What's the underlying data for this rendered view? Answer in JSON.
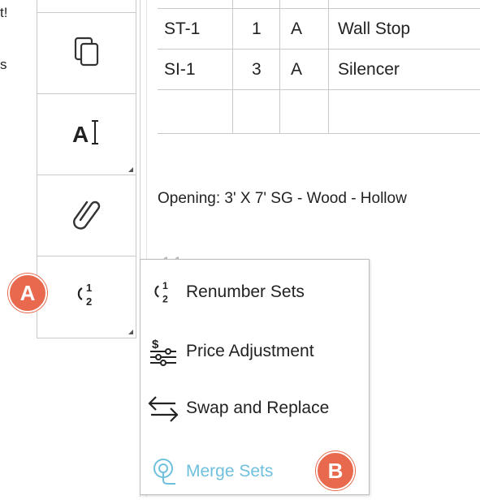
{
  "left_fragments": [
    "t!",
    "s"
  ],
  "table": {
    "rows": [
      [
        "ST-1",
        "1",
        "A",
        "Wall Stop"
      ],
      [
        "SI-1",
        "3",
        "A",
        "Silencer"
      ],
      [
        "",
        "",
        "",
        ""
      ]
    ]
  },
  "opening_label": "Opening:  3' X 7' SG - Wood - Hollow",
  "faint_text": "1  1",
  "toolbar": {
    "tools": [
      "copy-icon",
      "text-cursor-icon",
      "paperclip-icon",
      "renumber-icon"
    ]
  },
  "menu": {
    "items": [
      {
        "label": "Renumber Sets",
        "icon": "renumber-icon"
      },
      {
        "label": "Price Adjustment",
        "icon": "price-adjustment-icon"
      },
      {
        "label": "Swap and Replace",
        "icon": "swap-icon"
      },
      {
        "label": "Merge Sets",
        "icon": "merge-icon",
        "disabled": true
      }
    ]
  },
  "markers": {
    "a": "A",
    "b": "B"
  },
  "colors": {
    "marker": "#e8694d",
    "disabled_text": "#6fc0dd",
    "border": "#c9c9c9"
  }
}
